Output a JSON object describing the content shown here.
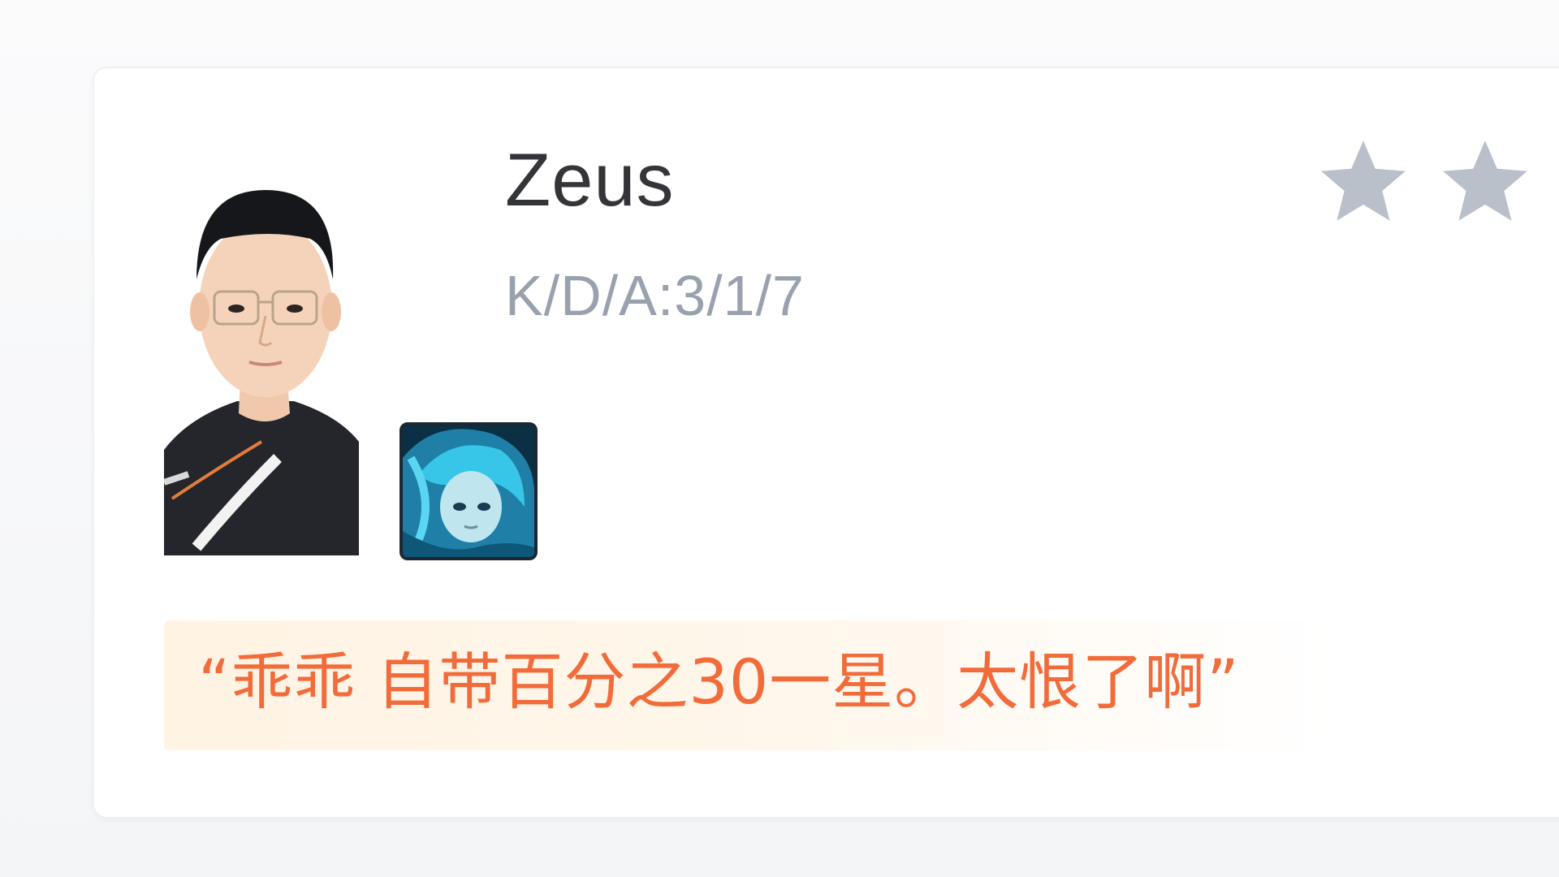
{
  "player": {
    "name": "Zeus",
    "kda": "K/D/A:3/1/7"
  },
  "rating": {
    "visible_stars": 2,
    "star_color": "#b9c0ca"
  },
  "quote": {
    "text": "“乖乖 自带百分之30一星。太恨了啊”"
  },
  "icons": {
    "avatar": "player-avatar",
    "hero": "champion-icon",
    "star": "star-icon"
  },
  "colors": {
    "name": "#333538",
    "kda": "#98a1ad",
    "quote_text": "#f26b3a",
    "quote_bg": "#fff3e3",
    "card_bg": "#ffffff"
  }
}
